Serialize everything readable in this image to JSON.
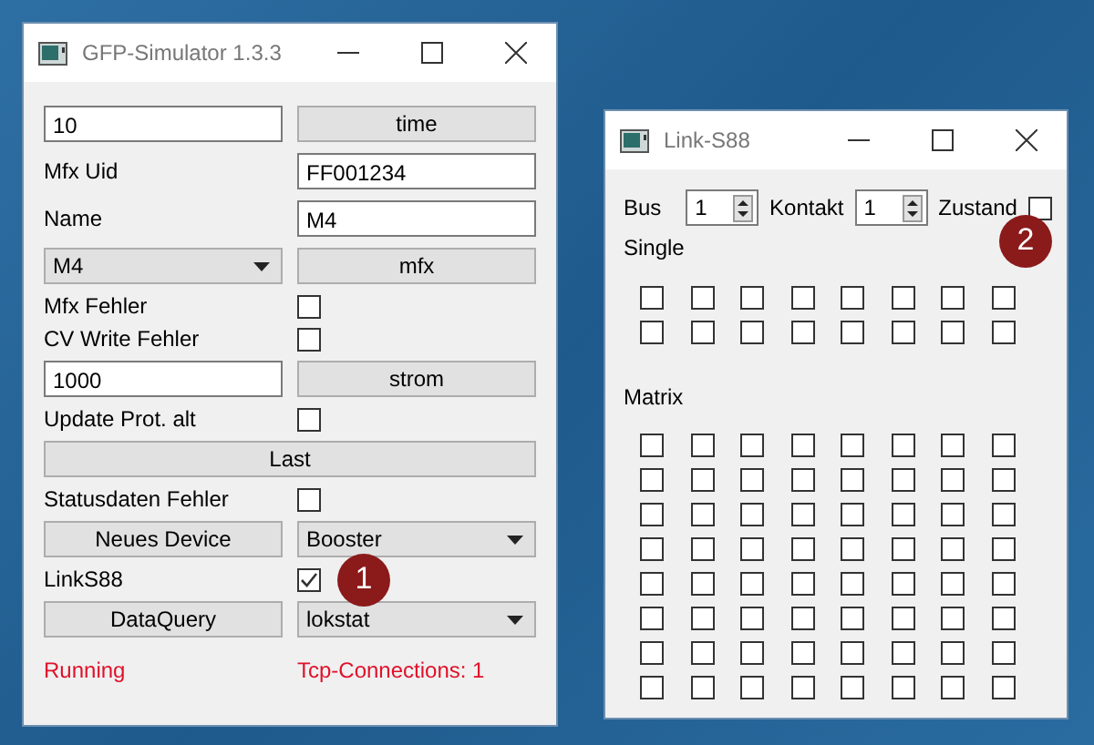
{
  "simulator": {
    "title": "GFP-Simulator 1.3.3",
    "rows": [
      {
        "kind": "input-button",
        "value": "10",
        "button": "time"
      },
      {
        "kind": "label-input",
        "label": "Mfx Uid",
        "value": "FF001234"
      },
      {
        "kind": "label-input",
        "label": "Name",
        "value": "M4"
      },
      {
        "kind": "select-button",
        "value": "M4",
        "button": "mfx"
      },
      {
        "kind": "label-checkbox",
        "label": "Mfx Fehler",
        "checked": false
      },
      {
        "kind": "label-checkbox",
        "label": "CV Write Fehler",
        "checked": false
      },
      {
        "kind": "input-button",
        "value": "1000",
        "button": "strom"
      },
      {
        "kind": "label-checkbox",
        "label": "Update Prot. alt",
        "checked": false
      },
      {
        "kind": "wide-button",
        "button": "Last"
      },
      {
        "kind": "label-checkbox",
        "label": "Statusdaten Fehler",
        "checked": false
      },
      {
        "kind": "button-select",
        "button": "Neues Device",
        "value": "Booster"
      },
      {
        "kind": "label-checkbox",
        "label": "LinkS88",
        "checked": true,
        "badge": "1"
      },
      {
        "kind": "button-select",
        "button": "DataQuery",
        "value": "lokstat"
      }
    ],
    "status": {
      "left": "Running",
      "right": "Tcp-Connections: 1"
    }
  },
  "link_s88": {
    "title": "Link-S88",
    "bus": {
      "label": "Bus",
      "value": "1"
    },
    "kontakt": {
      "label": "Kontakt",
      "value": "1"
    },
    "zustand": {
      "label": "Zustand",
      "checked": false,
      "badge": "2"
    },
    "single": {
      "label": "Single",
      "rows": [
        [
          false,
          false,
          false,
          false,
          false,
          false,
          false,
          false
        ],
        [
          false,
          false,
          false,
          false,
          false,
          false,
          false,
          false
        ]
      ]
    },
    "matrix": {
      "label": "Matrix",
      "rows": [
        [
          false,
          false,
          false,
          false,
          false,
          false,
          false,
          false
        ],
        [
          false,
          false,
          false,
          false,
          false,
          false,
          false,
          false
        ],
        [
          false,
          false,
          false,
          false,
          false,
          false,
          false,
          false
        ],
        [
          false,
          false,
          false,
          false,
          false,
          false,
          false,
          false
        ],
        [
          false,
          false,
          false,
          false,
          false,
          false,
          false,
          false
        ],
        [
          false,
          false,
          false,
          false,
          false,
          false,
          false,
          false
        ],
        [
          false,
          false,
          false,
          false,
          false,
          false,
          false,
          false
        ],
        [
          false,
          false,
          false,
          false,
          false,
          false,
          false,
          false
        ]
      ]
    }
  }
}
